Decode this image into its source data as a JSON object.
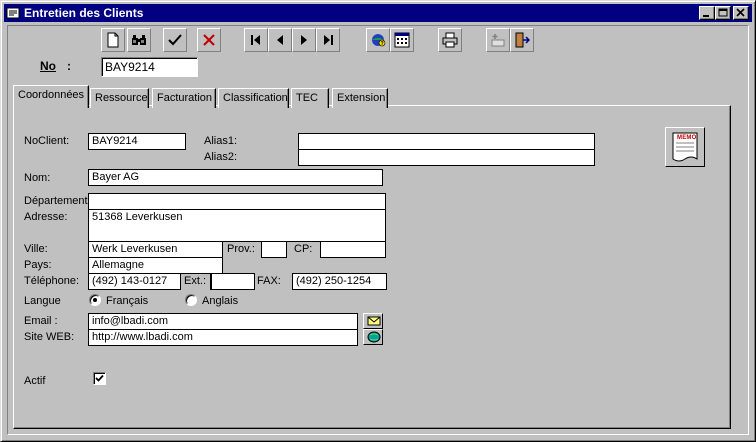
{
  "window": {
    "title": "Entretien des Clients"
  },
  "header": {
    "no_label": "No",
    "no_colon": ":",
    "no_value": "BAY9214"
  },
  "tabs": [
    {
      "label": "Coordonnées"
    },
    {
      "label": "Ressource"
    },
    {
      "label": "Facturation"
    },
    {
      "label": "Classification"
    },
    {
      "label": "TEC"
    },
    {
      "label": "Extension"
    }
  ],
  "form": {
    "noclient_label": "NoClient:",
    "noclient_value": "BAY9214",
    "alias1_label": "Alias1:",
    "alias1_value": "",
    "alias2_label": "Alias2:",
    "alias2_value": "",
    "nom_label": "Nom:",
    "nom_value": "Bayer AG",
    "departement_label": "Département:",
    "departement_value": "",
    "adresse_label": "Adresse:",
    "adresse_value": "51368 Leverkusen",
    "ville_label": "Ville:",
    "ville_value": "Werk Leverkusen",
    "prov_label": "Prov.:",
    "prov_value": "",
    "cp_label": "CP:",
    "cp_value": "",
    "pays_label": "Pays:",
    "pays_value": "Allemagne",
    "telephone_label": "Téléphone:",
    "telephone_value": "(492) 143-0127",
    "ext_label": "Ext.:",
    "ext_value": "",
    "fax_label": "FAX:",
    "fax_value": "(492) 250-1254",
    "langue_label": "Langue",
    "langue_options": [
      "Français",
      "Anglais"
    ],
    "langue_selected": "Français",
    "email_label": "Email :",
    "email_value": "info@lbadi.com",
    "site_label": "Site WEB:",
    "site_value": "http://www.lbadi.com",
    "actif_label": "Actif",
    "actif_checked": true,
    "memo_label": "MEMO"
  },
  "toolbar": {
    "icons": [
      "new-icon",
      "find-icon",
      "save-check-icon",
      "delete-x-icon",
      "first-record-icon",
      "prev-record-icon",
      "next-record-icon",
      "last-record-icon",
      "help-icon",
      "calculator-icon",
      "print-icon",
      "add-row-icon",
      "exit-door-icon"
    ]
  }
}
